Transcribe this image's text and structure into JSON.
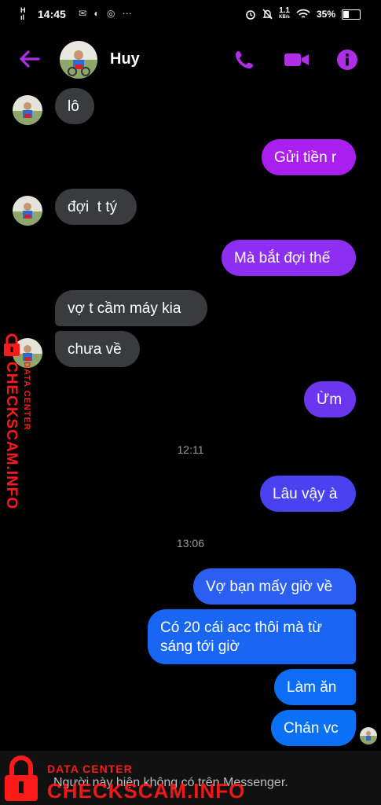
{
  "status_bar": {
    "network": "H\nill",
    "time": "14:45",
    "notification_icons": "✉ ◐ ◎ ⋯",
    "speed": "1.1",
    "speed_unit": "KB/s",
    "battery": "35%"
  },
  "header": {
    "contact_name": "Huy",
    "accent_color": "#b02fe6",
    "icons": [
      "back-arrow-icon",
      "phone-icon",
      "video-camera-icon",
      "info-icon"
    ]
  },
  "messages": [
    {
      "side": "in",
      "text": "lô"
    },
    {
      "side": "out",
      "text": "Gửi tiền r"
    },
    {
      "side": "in",
      "text": "đợi  t tý"
    },
    {
      "side": "out",
      "text": "Mà bắt đợi thế"
    },
    {
      "side": "in",
      "text": "vợ t cầm máy kia"
    },
    {
      "side": "in",
      "text": "chưa về"
    },
    {
      "side": "out",
      "text": "Ừm"
    },
    {
      "timestamp": "12:11"
    },
    {
      "side": "out",
      "text": "Lâu vậy à"
    },
    {
      "timestamp": "13:06"
    },
    {
      "side": "out",
      "text": "Vợ bạn mấy giờ về"
    },
    {
      "side": "out",
      "text": "Có 20 cái acc thôi mà từ\nsáng tới giờ"
    },
    {
      "side": "out",
      "text": "Làm ăn"
    },
    {
      "side": "out",
      "text": "Chán vc"
    }
  ],
  "footer": {
    "text": "Người này hiện không có trên Messenger."
  },
  "watermark": {
    "label": "DATA CENTER",
    "brand": "CHECKSCAM.INFO",
    "color": "#ff1a1a"
  }
}
